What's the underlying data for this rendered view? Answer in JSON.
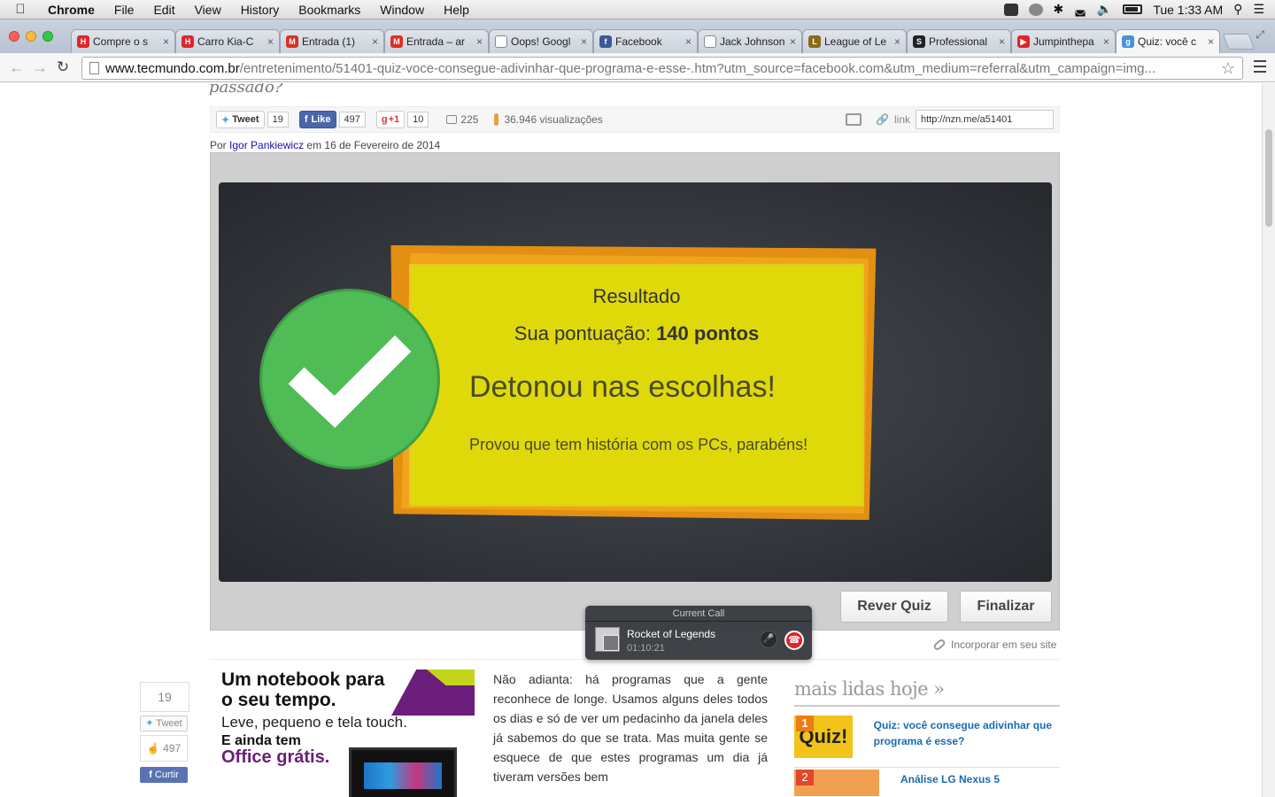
{
  "menubar": {
    "app": "Chrome",
    "items": [
      "File",
      "Edit",
      "View",
      "History",
      "Bookmarks",
      "Window",
      "Help"
    ],
    "clock": "Tue 1:33 AM"
  },
  "tabs": [
    {
      "title": "Compre o s",
      "favicon": "H",
      "color": "#e0252c"
    },
    {
      "title": "Carro Kia-C",
      "favicon": "H",
      "color": "#e0252c"
    },
    {
      "title": "Entrada (1)",
      "favicon": "M",
      "color": "#d93025"
    },
    {
      "title": "Entrada – ar",
      "favicon": "M",
      "color": "#d93025"
    },
    {
      "title": "Oops! Googl",
      "favicon": "",
      "color": "#ffffff"
    },
    {
      "title": "Facebook",
      "favicon": "f",
      "color": "#3b5998"
    },
    {
      "title": "Jack Johnson",
      "favicon": "",
      "color": "#ffffff"
    },
    {
      "title": "League of Le",
      "favicon": "L",
      "color": "#8a6a1a"
    },
    {
      "title": "Professional",
      "favicon": "S",
      "color": "#222222"
    },
    {
      "title": "Jumpinthepa",
      "favicon": "▶",
      "color": "#e0252c"
    },
    {
      "title": "Quiz: você c",
      "favicon": "g",
      "color": "#4a90d9"
    }
  ],
  "toolbar": {
    "url_host": "www.tecmundo.com.br",
    "url_path": "/entretenimento/51401-quiz-voce-consegue-adivinhar-que-programa-e-esse-.htm?utm_source=facebook.com&utm_medium=referral&utm_campaign=img..."
  },
  "article": {
    "title_fragment": "passado?",
    "byline_prefix": "Por",
    "author": "Igor Pankiewicz",
    "date": "em 16 de Fevereiro de 2014"
  },
  "share": {
    "tweet_label": "Tweet",
    "tweet_count": "19",
    "like_label": "Like",
    "like_count": "497",
    "gplus_label": "+1",
    "gplus_count": "10",
    "comments": "225",
    "views": "36.946 visualizações",
    "link_label": "link",
    "short_link": "http://nzn.me/a51401"
  },
  "quiz": {
    "heading": "Resultado",
    "score_prefix": "Sua pontuação:",
    "score_value": "140 pontos",
    "verdict": "Detonou nas escolhas!",
    "message": "Provou que tem história com os PCs, parabéns!",
    "review_button": "Rever Quiz",
    "finish_button": "Finalizar",
    "embed_label": "Incorporar em seu site"
  },
  "call": {
    "header": "Current Call",
    "name": "Rocket of Legends",
    "duration": "01:10:21"
  },
  "side_share": {
    "count": "19",
    "tweet_label": "Tweet",
    "like_count": "497",
    "fb_label": "Curtir"
  },
  "ad": {
    "line1": "Um notebook para",
    "line2": "o seu tempo.",
    "line3": "Leve, pequeno e tela touch.",
    "line4": "E ainda tem",
    "line5": "Office grátis."
  },
  "article_body": "Não adianta: há programas que a gente reconhece de longe. Usamos alguns deles todos os dias e só de ver um pedacinho da janela deles já sabemos do que se trata. Mas muita gente se esquece de que estes programas um dia já tiveram versões bem",
  "most_read": {
    "title": "mais lidas hoje »",
    "items": [
      {
        "rank": "1",
        "thumb": "Quiz!",
        "title": "Quiz: você consegue adivinhar que programa é esse?"
      },
      {
        "rank": "2",
        "title": "Análise LG Nexus 5"
      }
    ]
  }
}
